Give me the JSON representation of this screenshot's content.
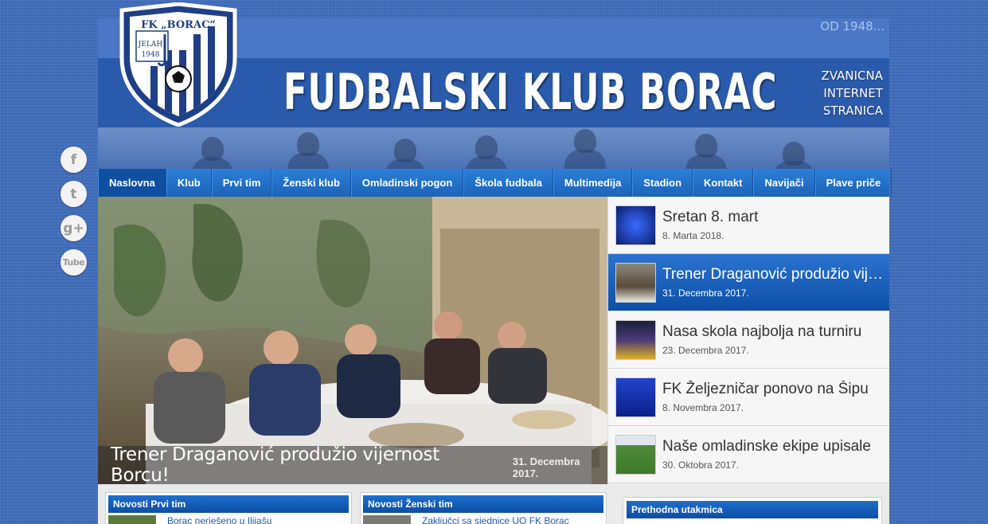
{
  "header": {
    "since": "OD 1948...",
    "title": "FUDBALSKI KLUB BORAC",
    "tagline": [
      "ZVANICNA",
      "INTERNET",
      "STRANICA"
    ],
    "logo_text_top": "FK „BORAC“",
    "logo_text_city": "JELAH",
    "logo_text_year": "1948"
  },
  "social": [
    {
      "icon": "facebook-icon",
      "glyph": "f"
    },
    {
      "icon": "twitter-icon",
      "glyph": "t"
    },
    {
      "icon": "google-plus-icon",
      "glyph": "g+"
    },
    {
      "icon": "youtube-icon",
      "glyph": "Tube"
    }
  ],
  "nav": [
    "Naslovna",
    "Klub",
    "Prvi tim",
    "Ženski klub",
    "Omladinski pogon",
    "Škola fudbala",
    "Multimedija",
    "Stadion",
    "Kontakt",
    "Navijači",
    "Plave priče"
  ],
  "slider": {
    "title": "Trener Draganović produžio vijernost Borcu!",
    "date": "31. Decembra 2017."
  },
  "news": [
    {
      "title": "Sretan 8. mart",
      "date": "8. Marta 2018.",
      "thumb_color": "#1a3f9e"
    },
    {
      "title": "Trener Draganović produžio vijernost Borcu!",
      "date": "31. Decembra 2017.",
      "thumb_color": "#6b5a45"
    },
    {
      "title": "Nasa skola najbolja na turniru",
      "date": "23. Decembra 2017.",
      "thumb_color": "#3a3f6e"
    },
    {
      "title": "FK Željezničar ponovo na Šipu",
      "date": "8. Novembra 2017.",
      "thumb_color": "#1e3fae"
    },
    {
      "title": "Naše omladinske ekipe upisale",
      "date": "30. Oktobra 2017.",
      "thumb_color": "#4e8a3a"
    }
  ],
  "boxes": {
    "first_team": {
      "heading": "Novosti Prvi tim",
      "item": "Borac nerješeno u Ilijašu"
    },
    "women": {
      "heading": "Novosti Ženski tim",
      "item": "Zaključci sa sjednice UO FK Borac"
    },
    "previous": {
      "heading": "Prethodna utakmica"
    }
  },
  "colors": {
    "accent": "#1f6ecb",
    "header": "#2a5aab",
    "background": "#3f6dbb"
  }
}
